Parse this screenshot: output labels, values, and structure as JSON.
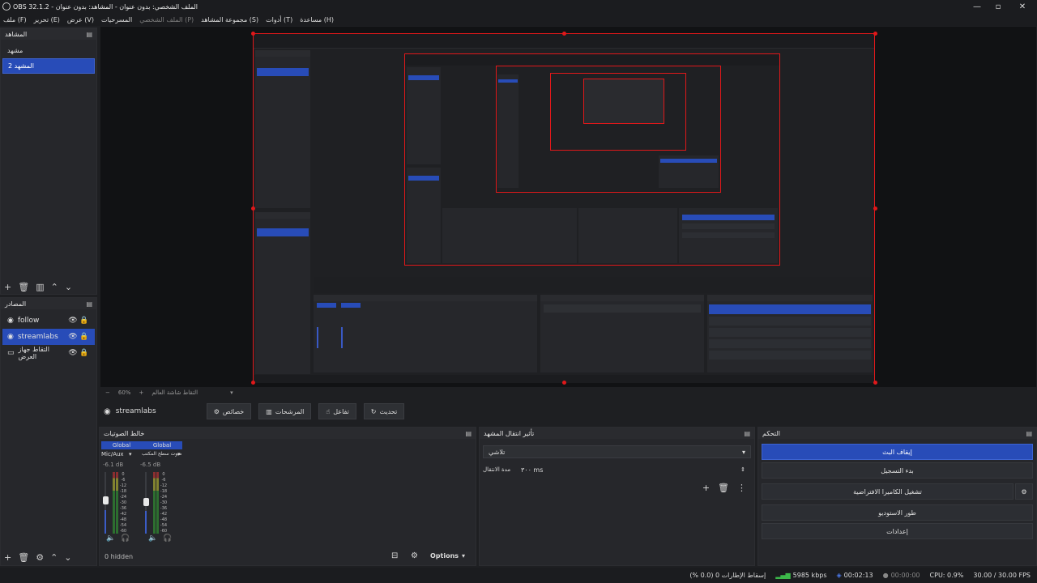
{
  "window": {
    "title": "OBS 32.1.2 - الملف الشخصي: بدون عنوان - المشاهد: بدون عنوان"
  },
  "menu": [
    "ملف (F)",
    "تحرير (E)",
    "عرض (V)",
    "المسرحيات",
    "الملف الشخصي (P)",
    "مجموعة المشاهد (S)",
    "أدوات (T)",
    "مساعدة (H)"
  ],
  "scenes": {
    "title": "المشاهد",
    "items": [
      "مشهد",
      "المشهد 2"
    ],
    "selected": 1
  },
  "sources": {
    "title": "المصادر",
    "items": [
      {
        "name": "follow",
        "icon": "globe-icon"
      },
      {
        "name": "streamlabs",
        "icon": "globe-icon"
      },
      {
        "name": "التقاط جهاز العرض",
        "icon": "monitor-icon"
      }
    ],
    "selected": 1
  },
  "zoom": {
    "value": "60%",
    "label": "التقاط شاشة العالم"
  },
  "context": {
    "source": "streamlabs",
    "buttons": [
      "خصائص",
      "المرشحات",
      "تفاعل",
      "تحديث"
    ]
  },
  "mixer": {
    "title": "خالط الصوتيات",
    "channels": [
      {
        "badge": "Global",
        "name": "Mic/Aux",
        "db": "-6.1 dB",
        "level": 0.55
      },
      {
        "badge": "Global",
        "name": "صوت سطح المكتب",
        "db": "-6.5 dB",
        "level": 0.52
      }
    ],
    "ticks": [
      "0",
      "-6",
      "-12",
      "-18",
      "-24",
      "-30",
      "-36",
      "-42",
      "-48",
      "-54",
      "-60"
    ],
    "hidden": "0 hidden",
    "options": "Options"
  },
  "transitions": {
    "title": "تأثير انتقال المشهد",
    "selected": "تلاشي",
    "duration_label": "مدة الانتقال",
    "duration": "٣٠٠ ms"
  },
  "controls": {
    "title": "التحكم",
    "buttons": [
      "إيقاف البث",
      "بدء التسجيل",
      "تشغيل الكاميرا الافتراضية",
      "طور الاستوديو",
      "إعدادات"
    ]
  },
  "status": {
    "dropped": "إسقاط الإطارات 0 (0.0 %)",
    "bitrate": "5985 kbps",
    "stream_time": "00:02:13",
    "rec_time": "00:00:00",
    "cpu": "CPU: 0.9%",
    "fps": "30.00 / 30.00 FPS"
  },
  "colors": {
    "accent": "#284cb8",
    "selection_border": "#e0181a",
    "bg": "#1e1f22"
  }
}
